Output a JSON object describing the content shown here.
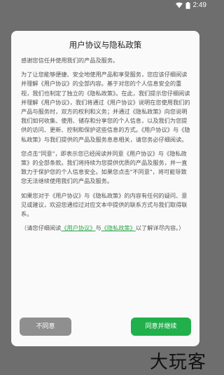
{
  "status_bar": {
    "time": "2:49"
  },
  "dialog": {
    "title": "用户协议与隐私政策",
    "paragraphs": {
      "p1": "感谢您信任并使用我们的产品及服务。",
      "p2": "为了让您能够便捷、安全地使用产品和享受服务，您应该仔细阅读并理解《用户协议》的全部内容。基于对您的个人信息安全的重视，我们也制定了独立的《隐私政策》。在此，我们提示您仔细阅读并理解《用户协议》，我们将通过《用户协议》说明在您使用我们的产品与服务时，双方的权利和义务；并通过《隐私政策》向您说明我们如何收集、使用、储存和分享您的个人信息，以及我们为您提供的访问、更新、控制和保护这些信息的方式。《用户协议》与《隐私政策》与我们提供的产品及服务息息相关，请您务必仔细阅读。",
      "p3": "您点击\"同意\"，即表示您已经阅读并同意《用户协议》与《隐私政策》的全部条款。我们将持续为您提供优质的产品及服务，并一直致力于保护您的个人信息安全。如果您点击\"不同意\"，将可能导致您无法继续使用我们的产品及服务。",
      "p4": "如果您对于《用户协议》与《隐私政策》的内容有任何的疑问、意见或建议，欢迎您通综过对应文本中提供的联系方式与我们取得联系。",
      "p5_prefix": "（请您仔细阅读",
      "p5_link1": "《用户协议》",
      "p5_mid": "与",
      "p5_link2": "《隐私政策》",
      "p5_suffix": "以了解详尽内容。）"
    },
    "buttons": {
      "disagree": "不同意",
      "agree": "同意并继续"
    }
  },
  "watermark": "大玩客",
  "colors": {
    "accent": "#21b04b",
    "link": "#2ca84a",
    "disabled_button": "#8f8f8f",
    "overlay": "#6e6e6e"
  }
}
